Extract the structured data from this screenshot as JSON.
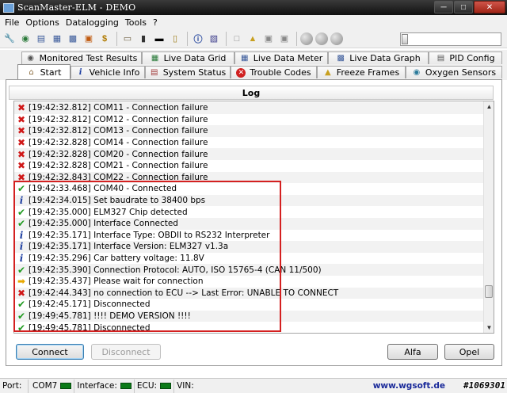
{
  "window": {
    "title": "ScanMaster-ELM - DEMO"
  },
  "menu": [
    "File",
    "Options",
    "Datalogging",
    "Tools",
    "?"
  ],
  "tabs_top": [
    {
      "label": "Monitored Test Results",
      "icon": "gauge-icon"
    },
    {
      "label": "Live Data Grid",
      "icon": "grid-icon"
    },
    {
      "label": "Live Data Meter",
      "icon": "meter-icon"
    },
    {
      "label": "Live Data Graph",
      "icon": "graph-icon"
    },
    {
      "label": "PID Config",
      "icon": "config-icon"
    }
  ],
  "tabs_bottom": [
    {
      "label": "Start",
      "icon": "home-icon",
      "active": true
    },
    {
      "label": "Vehicle Info",
      "icon": "info-icon"
    },
    {
      "label": "System Status",
      "icon": "status-icon"
    },
    {
      "label": "Trouble Codes",
      "icon": "error-icon"
    },
    {
      "label": "Freeze Frames",
      "icon": "freeze-icon"
    },
    {
      "label": "Oxygen Sensors",
      "icon": "sensor-icon"
    }
  ],
  "log": {
    "header": "Log",
    "entries": [
      {
        "type": "error",
        "text": "[19:42:32.812] COM11 - Connection failure"
      },
      {
        "type": "error",
        "text": "[19:42:32.812] COM12 - Connection failure"
      },
      {
        "type": "error",
        "text": "[19:42:32.812] COM13 - Connection failure"
      },
      {
        "type": "error",
        "text": "[19:42:32.828] COM14 - Connection failure"
      },
      {
        "type": "error",
        "text": "[19:42:32.828] COM20 - Connection failure"
      },
      {
        "type": "error",
        "text": "[19:42:32.828] COM21 - Connection failure"
      },
      {
        "type": "error",
        "text": "[19:42:32.843] COM22 - Connection failure"
      },
      {
        "type": "ok",
        "text": "[19:42:33.468] COM40 - Connected"
      },
      {
        "type": "info",
        "text": "[19:42:34.015] Set baudrate to 38400 bps"
      },
      {
        "type": "ok",
        "text": "[19:42:35.000] ELM327 Chip detected"
      },
      {
        "type": "ok",
        "text": "[19:42:35.000] Interface Connected"
      },
      {
        "type": "info",
        "text": "[19:42:35.171] Interface Type: OBDII to RS232 Interpreter"
      },
      {
        "type": "info",
        "text": "[19:42:35.171] Interface Version: ELM327 v1.3a"
      },
      {
        "type": "info",
        "text": "[19:42:35.296] Car battery voltage: 11.8V"
      },
      {
        "type": "ok",
        "text": "[19:42:35.390] Connection Protocol: AUTO, ISO 15765-4 (CAN 11/500)"
      },
      {
        "type": "warn",
        "text": "[19:42:35.437] Please wait for connection"
      },
      {
        "type": "error",
        "text": "[19:42:44.343] no connection to ECU --> Last Error: UNABLE TO CONNECT"
      },
      {
        "type": "ok",
        "text": "[19:42:45.171] Disconnected"
      },
      {
        "type": "ok",
        "text": "[19:49:45.781] !!!! DEMO VERSION !!!!"
      },
      {
        "type": "ok",
        "text": "[19:49:45.781] Disconnected"
      }
    ]
  },
  "buttons": {
    "connect": "Connect",
    "disconnect": "Disconnect",
    "alfa": "Alfa",
    "opel": "Opel"
  },
  "statusbar": {
    "port_label": "Port:",
    "port_value": "COM7",
    "interface_label": "Interface:",
    "ecu_label": "ECU:",
    "vin_label": "VIN:",
    "website": "www.wgsoft.de"
  },
  "watermark": "#1069301",
  "colors": {
    "error": "#d01818",
    "ok": "#1f9a1f",
    "info": "#1d3ea0",
    "warn": "#e8a800",
    "highlight": "#d42020"
  }
}
